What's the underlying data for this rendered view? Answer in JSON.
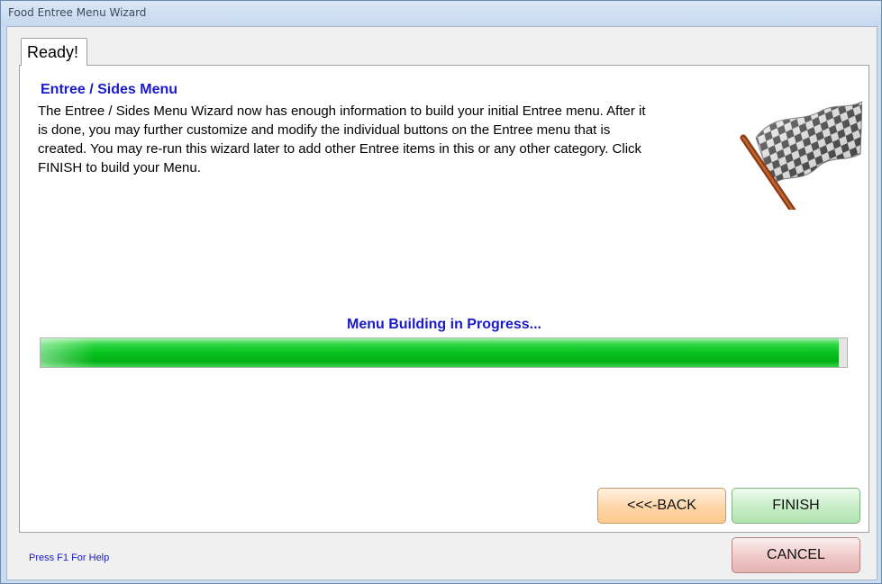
{
  "window": {
    "title": "Food Entree Menu Wizard"
  },
  "tab": {
    "label": "Ready!"
  },
  "panel": {
    "heading": "Entree / Sides Menu",
    "body": "The Entree / Sides Menu Wizard now has enough information to build your initial Entree menu.  After it is done, you may further customize and modify the individual buttons on the Entree menu that is created.  You may re-run this wizard later to add other Entree items in this or any other category.  Click FINISH to build your Menu.",
    "image_icon": "checkered-flag-icon"
  },
  "progress": {
    "caption": "Menu Building in Progress...",
    "fraction": 0.99,
    "color": "#06c11e"
  },
  "buttons": {
    "back": "<<<-BACK",
    "finish": "FINISH",
    "cancel": "CANCEL"
  },
  "footer": {
    "help": "Press F1 For Help"
  }
}
